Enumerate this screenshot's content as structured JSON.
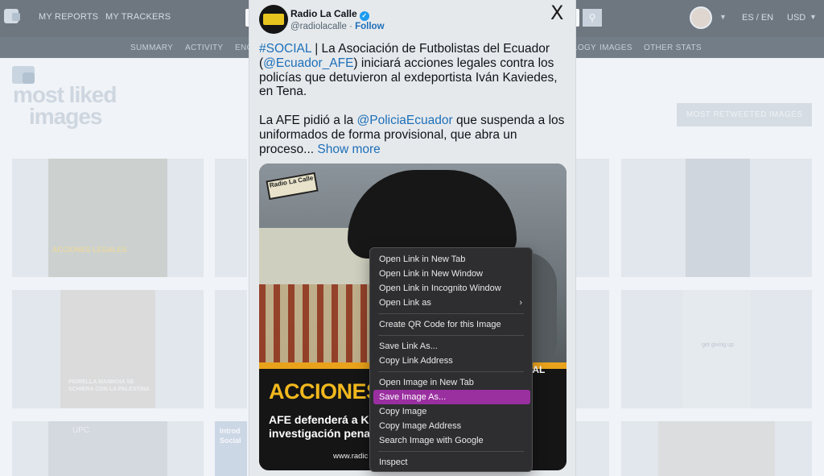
{
  "background": {
    "topnav": [
      "MY REPORTS",
      "MY TRACKERS"
    ],
    "lang": "ES / EN",
    "currency": "USD",
    "subnav": [
      "SUMMARY",
      "ACTIVITY",
      "ENG",
      "TECHNOLOGY",
      "IMAGES",
      "OTHER STATS"
    ],
    "page_title": [
      "most liked",
      "images"
    ],
    "most_retweeted_button": "MOST RETWEETED IMAGES",
    "tile_texts": {
      "tile1_headline": "ACCIONES LEGALES",
      "tile4_text": "PIORELLA MANNOIA SE SCHIERA CON LA PALESTINA",
      "tile7_text": "UPC",
      "tile8_text": "Introd Social",
      "tile9_text": "get giving up"
    }
  },
  "tweet": {
    "account_name": "Radio La Calle",
    "handle": "@radiolacalle",
    "separator": "·",
    "follow": "Follow",
    "close": "X",
    "body": {
      "hashtag": "#SOCIAL",
      "text1": " | La Asociación de Futbolistas del Ecuador (",
      "mention1": "@Ecuador_AFE",
      "text2": ") iniciará acciones legales contra los policías que detuvieron al exdeportista Iván Kaviedes, en Tena.",
      "text3": "La AFE pidió a la ",
      "mention2": "@PoliciaEcuador",
      "text4": " que suspenda a los uniformados de forma provisional, que abra un proceso...",
      "show_more": "Show more"
    },
    "media": {
      "brand": "Radio La Calle",
      "headline": "ACCIONES LEG",
      "subline": "AFE defenderá a K investigación pena",
      "badge": "IAL",
      "url": "www.radic"
    }
  },
  "context_menu": {
    "items": [
      {
        "label": "Open Link in New Tab"
      },
      {
        "label": "Open Link in New Window"
      },
      {
        "label": "Open Link in Incognito Window"
      },
      {
        "label": "Open Link as",
        "submenu": true
      },
      {
        "label": "Create QR Code for this Image"
      },
      {
        "label": "Save Link As..."
      },
      {
        "label": "Copy Link Address"
      },
      {
        "label": "Open Image in New Tab"
      },
      {
        "label": "Save Image As...",
        "highlighted": true
      },
      {
        "label": "Copy Image"
      },
      {
        "label": "Copy Image Address"
      },
      {
        "label": "Search Image with Google"
      },
      {
        "label": "Inspect"
      }
    ],
    "highlight_color": "#9a2fa0"
  },
  "colors": {
    "link": "#1d6fb8",
    "verified": "#1d9bf0",
    "menu_bg": "#2e2e30"
  }
}
